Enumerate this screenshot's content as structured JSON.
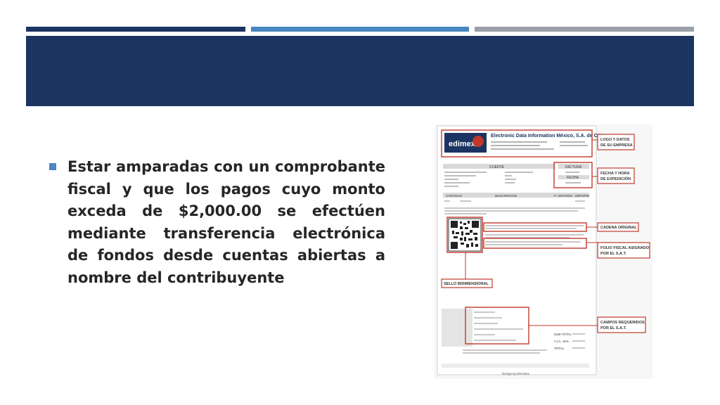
{
  "slide": {
    "bullet_text": "Estar amparadas con un comprobante fiscal y que los pagos cuyo monto exceda de $2,000.00 se efectúen mediante transferencia electrónica de fondos desde cuentas abiertas a nombre del contribuyente"
  },
  "colors": {
    "dark_navy": "#1c3461",
    "accent_blue": "#4a86c0",
    "gray": "#9aa0a8",
    "callout_red": "#c0392b"
  },
  "invoice": {
    "logo": "edimex",
    "company_name": "Electronic Data Information México, S.A. de C.V.",
    "table_headers": {
      "client": "CLIENTE",
      "invoice": "FACTURA",
      "date": "FECHA",
      "quantity": "CANTIDAD",
      "description": "DESCRIPCION",
      "unit_price": "P. UNITARIO",
      "amount": "IMPORTE"
    },
    "totals": {
      "subtotal": "SUB-TOTAL",
      "iva": "I.V.A. 16%",
      "total": "TOTAL"
    },
    "footer": "Design by EDI-Mex",
    "callouts": {
      "logo": [
        "LOGO Y DATOS",
        "DE SU EMPRESA"
      ],
      "date": [
        "FECHA Y HORA",
        "DE EXPEDICIÓN"
      ],
      "chain": [
        "CADENA ORIGINAL"
      ],
      "folio": [
        "FOLIO FISCAL ASIGNADO",
        "POR EL S.A.T."
      ],
      "seal": [
        "SELLO BIDIMENSIONAL"
      ],
      "fields": [
        "CAMPOS REQUERIDOS",
        "POR EL S.A.T."
      ]
    }
  }
}
